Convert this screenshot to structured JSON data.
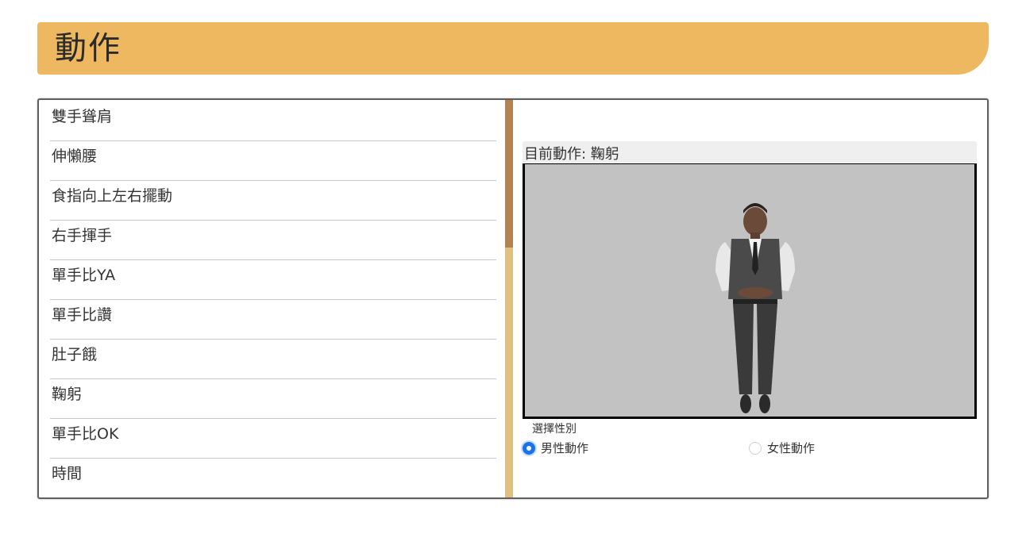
{
  "header": {
    "title": "動作"
  },
  "actions": {
    "items": [
      {
        "label": "雙手聳肩"
      },
      {
        "label": "伸懶腰"
      },
      {
        "label": "食指向上左右擺動"
      },
      {
        "label": "右手揮手"
      },
      {
        "label": "單手比YA"
      },
      {
        "label": "單手比讚"
      },
      {
        "label": "肚子餓"
      },
      {
        "label": "鞠躬"
      },
      {
        "label": "單手比OK"
      },
      {
        "label": "時間"
      }
    ],
    "scroll_position": 0
  },
  "current": {
    "label": "目前動作: 鞠躬"
  },
  "viewer": {
    "figure": "male-avatar-bowing"
  },
  "gender": {
    "label": "選擇性別",
    "options": [
      {
        "label": "男性動作",
        "selected": true
      },
      {
        "label": "女性動作",
        "selected": false
      }
    ]
  },
  "colors": {
    "header": "#edb85f",
    "scroll_thumb": "#b38250",
    "scroll_track": "#e0c080",
    "radio_accent": "#1a73e8"
  }
}
